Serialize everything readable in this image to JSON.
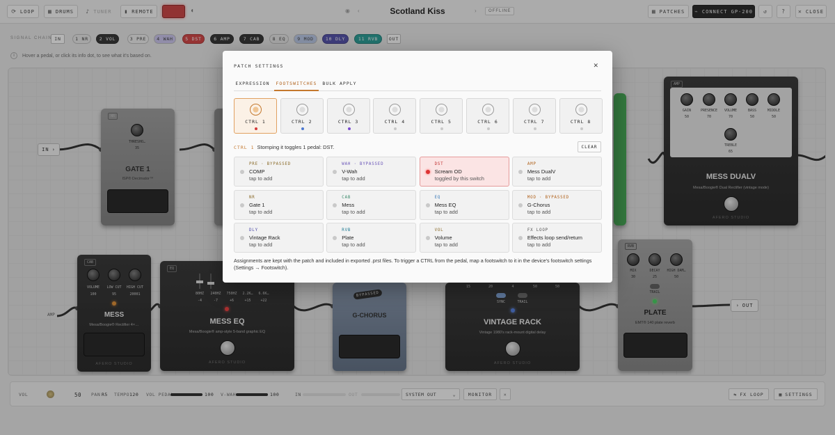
{
  "topbar": {
    "loop": "LOOP",
    "drums": "DRUMS",
    "tuner": "TUNER",
    "remote": "REMOTE",
    "rec_label": "",
    "patch_title": "Scotland Kiss",
    "status": "OFFLINE",
    "patches": "PATCHES",
    "connect": "CONNECT GP-200",
    "close": "CLOSE"
  },
  "chain": {
    "label": "SIGNAL CHAIN",
    "chips": [
      {
        "label": "IN",
        "color": "#ffffff"
      },
      {
        "label": "1 NR",
        "color": "#e8e8e8"
      },
      {
        "label": "2 VOL",
        "color": "#2a2a2a"
      },
      {
        "label": "3 PRE",
        "color": "#eeeeee"
      },
      {
        "label": "4 WAH",
        "color": "#c9c3ee"
      },
      {
        "label": "5 DST",
        "color": "#d23b3b"
      },
      {
        "label": "6 AMP",
        "color": "#2a2a2a"
      },
      {
        "label": "7 CAB",
        "color": "#2a2a2a"
      },
      {
        "label": "8 EQ",
        "color": "#e6e6e6"
      },
      {
        "label": "9 MOD",
        "color": "#b9c8e8"
      },
      {
        "label": "10 DLY",
        "color": "#4b49a8"
      },
      {
        "label": "11 RVB",
        "color": "#1e9a93"
      },
      {
        "label": "OUT",
        "color": "#ffffff"
      }
    ],
    "hint": "Hover a pedal, or click its info dot, to see what it's based on."
  },
  "board": {
    "in_label": "IN",
    "out_label": "OUT",
    "amp_label": "AMP",
    "gate": {
      "name": "GATE 1",
      "sub": "ISP® Decimator™",
      "knob": "THRESHO…",
      "value": "35",
      "tag": "NR"
    },
    "mess_amp": {
      "name": "MESS DUALV",
      "sub": "Mesa/Boogie® Dual Rectifier (vintage mode)",
      "tag": "AMP",
      "brand": "AFERO STUDIO",
      "knobs": [
        {
          "label": "GAIN",
          "value": "50"
        },
        {
          "label": "PRESENCE",
          "value": "70"
        },
        {
          "label": "VOLUME",
          "value": "70"
        },
        {
          "label": "BASS",
          "value": "50"
        },
        {
          "label": "MIDDLE",
          "value": "50"
        }
      ],
      "treble": {
        "label": "TREBLE",
        "value": "65"
      }
    },
    "mess_cab": {
      "name": "MESS",
      "sub": "Mesa/Boogie® Rectifier 4×…",
      "tag": "CAB",
      "brand": "AFERO STUDIO",
      "knobs": [
        {
          "label": "VOLUME",
          "value": "100"
        },
        {
          "label": "LOW CUT",
          "value": "95"
        },
        {
          "label": "HIGH CUT",
          "value": "20001"
        }
      ]
    },
    "mess_eq": {
      "name": "MESS EQ",
      "sub": "Mesa/Boogie® amp-style 5-band graphic EQ",
      "tag": "EQ",
      "brand": "AFERO STUDIO",
      "bands": [
        "80HZ",
        "240HZ",
        "750HZ",
        "2.2K…",
        "6.6K…"
      ],
      "gains": [
        "-4",
        "-7",
        "+6",
        "+15",
        "+22"
      ]
    },
    "chorus": {
      "name": "G-CHORUS",
      "badge": "BYPASSED"
    },
    "vintage": {
      "name": "VINTAGE RACK",
      "sub": "Vintage 1980's rack-mount digital delay",
      "brand": "AFERO STUDIO",
      "nums": [
        "15",
        "20",
        "4",
        "50",
        "50"
      ],
      "sync": "SYNC",
      "trail": "TRAIL"
    },
    "plate": {
      "name": "PLATE",
      "sub": "EMT® 140 plate reverb",
      "tag": "RVB",
      "knobs": [
        {
          "label": "MIX",
          "value": "30"
        },
        {
          "label": "DECAY",
          "value": "25"
        },
        {
          "label": "HIGH DAM…",
          "value": "50"
        }
      ],
      "trail": "TRAIL"
    }
  },
  "bottom": {
    "vol_label": "VOL",
    "vol_value": "50",
    "pan_label": "PAN",
    "pan_value": "R5",
    "tempo_label": "TEMPO",
    "tempo_value": "120",
    "volpedal_label": "VOL PEDAL",
    "volpedal_value": "100",
    "vwah_label": "V-WAH",
    "vwah_value": "100",
    "in_label": "IN",
    "out_label": "OUT",
    "output_select": "SYSTEM OUT",
    "monitor": "MONITOR",
    "fxloop": "FX LOOP",
    "settings": "SETTINGS"
  },
  "modal": {
    "title": "PATCH SETTINGS",
    "tabs": [
      "EXPRESSION",
      "FOOTSWITCHES",
      "BULK APPLY"
    ],
    "ctrls": [
      {
        "label": "CTRL 1",
        "dot": "#d33b3b"
      },
      {
        "label": "CTRL 2",
        "dot": "#4b78d0"
      },
      {
        "label": "CTRL 3",
        "dot": "#7a4bd0"
      },
      {
        "label": "CTRL 4",
        "dot": "#c8c8c8"
      },
      {
        "label": "CTRL 5",
        "dot": "#c8c8c8"
      },
      {
        "label": "CTRL 6",
        "dot": "#c8c8c8"
      },
      {
        "label": "CTRL 7",
        "dot": "#c8c8c8"
      },
      {
        "label": "CTRL 8",
        "dot": "#c8c8c8"
      }
    ],
    "info_key": "CTRL 1",
    "info_text": "Stomping it toggles 1 pedal: DST.",
    "clear": "CLEAR",
    "slots": [
      {
        "head": "PRE · BYPASSED",
        "color": "#8a6b2a",
        "name": "COMP",
        "state": "tap to add"
      },
      {
        "head": "WAH · BYPASSED",
        "color": "#6a55b8",
        "name": "V-Wah",
        "state": "tap to add"
      },
      {
        "head": "DST",
        "color": "#c23333",
        "name": "Scream OD",
        "state": "toggled by this switch"
      },
      {
        "head": "AMP",
        "color": "#b0611a",
        "name": "Mess DualV",
        "state": "tap to add"
      },
      {
        "head": "NR",
        "color": "#8a6b2a",
        "name": "Gate 1",
        "state": "tap to add"
      },
      {
        "head": "CAB",
        "color": "#3a8a6b",
        "name": "Mess",
        "state": "tap to add"
      },
      {
        "head": "EQ",
        "color": "#3a7ab8",
        "name": "Mess EQ",
        "state": "tap to add"
      },
      {
        "head": "MOD · BYPASSED",
        "color": "#b0611a",
        "name": "G-Chorus",
        "state": "tap to add"
      },
      {
        "head": "DLY",
        "color": "#4b49a8",
        "name": "Vintage Rack",
        "state": "tap to add"
      },
      {
        "head": "RVB",
        "color": "#1e7a93",
        "name": "Plate",
        "state": "tap to add"
      },
      {
        "head": "VOL",
        "color": "#8a6b2a",
        "name": "Volume",
        "state": "tap to add"
      },
      {
        "head": "FX LOOP",
        "color": "#555555",
        "name": "Effects loop send/return",
        "state": "tap to add"
      }
    ],
    "note": "Assignments are kept with the patch and included in exported .prst files. To trigger a CTRL from the pedal, map a footswitch to it in the device's footswitch settings (Settings → Footswitch)."
  }
}
